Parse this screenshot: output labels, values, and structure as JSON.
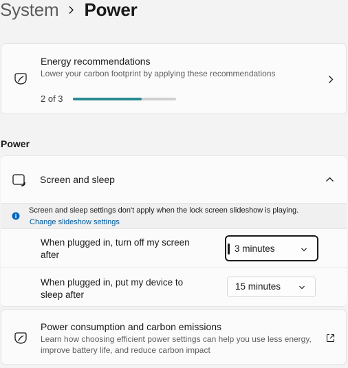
{
  "breadcrumb": {
    "parent": "System",
    "current": "Power"
  },
  "energy": {
    "title": "Energy recommendations",
    "subtitle": "Lower your carbon footprint by applying these recommendations",
    "progress_text": "2 of 3",
    "progress_fraction": 0.667
  },
  "power_section": {
    "header": "Power"
  },
  "screen_sleep": {
    "title": "Screen and sleep",
    "info_text": "Screen and sleep settings don't apply when the lock screen slideshow is playing.",
    "info_link": "Change slideshow settings",
    "screen_off": {
      "label": "When plugged in, turn off my screen after",
      "value": "3 minutes"
    },
    "sleep": {
      "label": "When plugged in, put my device to sleep after",
      "value": "15 minutes"
    }
  },
  "consumption": {
    "title": "Power consumption and carbon emissions",
    "subtitle": "Learn how choosing efficient power settings can help you use less energy, improve battery life, and reduce carbon impact"
  },
  "colors": {
    "accent": "#2b8a92",
    "link": "#005a9e",
    "info": "#0067c0"
  }
}
